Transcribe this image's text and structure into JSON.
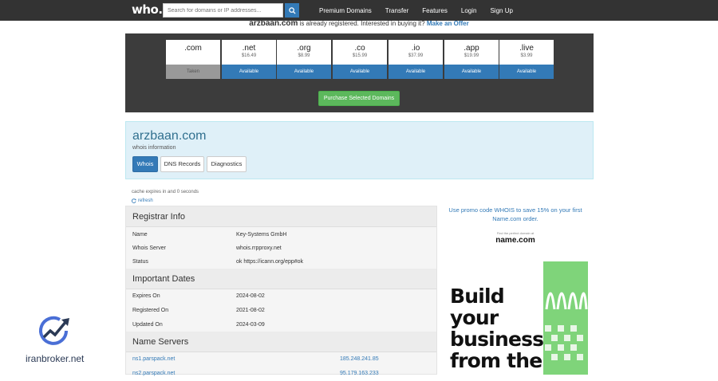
{
  "navbar": {
    "logo": "who.is",
    "search_placeholder": "Search for domains or IP addresses...",
    "links": [
      "Premium Domains",
      "Transfer",
      "Features",
      "Login",
      "Sign Up"
    ]
  },
  "banner": {
    "domain": "arzbaan.com",
    "text": " is already registered. ",
    "interest": "Interested in buying it? ",
    "offer": "Make an Offer"
  },
  "tlds": [
    {
      "name": ".com",
      "price": "",
      "status": "Taken"
    },
    {
      "name": ".net",
      "price": "$16.49",
      "status": "Available"
    },
    {
      "name": ".org",
      "price": "$8.99",
      "status": "Available"
    },
    {
      "name": ".co",
      "price": "$15.99",
      "status": "Available"
    },
    {
      "name": ".io",
      "price": "$37.99",
      "status": "Available"
    },
    {
      "name": ".app",
      "price": "$19.99",
      "status": "Available"
    },
    {
      "name": ".live",
      "price": "$3.99",
      "status": "Available"
    }
  ],
  "purchase_label": "Purchase Selected Domains",
  "info": {
    "domain": "arzbaan.com",
    "subtitle": "whois information",
    "tabs": [
      "Whois",
      "DNS Records",
      "Diagnostics"
    ]
  },
  "cache": {
    "text": "cache expires in and 0 seconds",
    "refresh": "refresh"
  },
  "registrar": {
    "title": "Registrar Info",
    "rows": [
      {
        "k": "Name",
        "v": "Key-Systems GmbH"
      },
      {
        "k": "Whois Server",
        "v": "whois.rrpproxy.net"
      },
      {
        "k": "Status",
        "v": "ok https://icann.org/epp#ok"
      }
    ]
  },
  "dates": {
    "title": "Important Dates",
    "rows": [
      {
        "k": "Expires On",
        "v": "2024-08-02"
      },
      {
        "k": "Registered On",
        "v": "2021-08-02"
      },
      {
        "k": "Updated On",
        "v": "2024-03-09"
      }
    ]
  },
  "nameservers": {
    "title": "Name Servers",
    "rows": [
      {
        "ns": "ns1.parspack.net",
        "ip": "185.248.241.85"
      },
      {
        "ns": "ns2.parspack.net",
        "ip": "95.179.163.233"
      }
    ]
  },
  "ad": {
    "promo": "Use promo code WHOIS to save 15% on your first Name.com order.",
    "small": "Find the perfect domain at",
    "logo": "name.com",
    "headline": [
      "Build",
      "your",
      "business",
      "from the"
    ]
  },
  "watermark": "iranbroker.net",
  "colors": {
    "navbar": "#333333",
    "primary": "#337ab7",
    "success": "#5cb85c",
    "tld_panel": "#3c3c3c",
    "info_panel": "#dff0f8"
  }
}
